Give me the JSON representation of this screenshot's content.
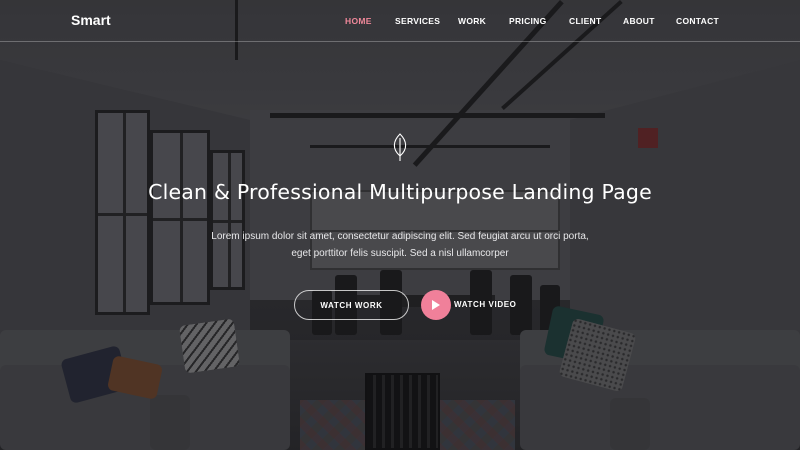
{
  "brand": {
    "logo_text": "Smart"
  },
  "nav": {
    "items": [
      {
        "label": "HOME",
        "active": true
      },
      {
        "label": "SERVICES",
        "active": false
      },
      {
        "label": "WORK",
        "active": false
      },
      {
        "label": "PRICING",
        "active": false
      },
      {
        "label": "CLIENT",
        "active": false
      },
      {
        "label": "ABOUT",
        "active": false
      },
      {
        "label": "CONTACT",
        "active": false
      }
    ]
  },
  "hero": {
    "icon": "leaf-icon",
    "headline": "Clean & Professional Multipurpose Landing Page",
    "subtext_line1": "Lorem ipsum dolor sit amet, consectetur adipiscing elit. Sed feugiat arcu ut orci porta,",
    "subtext_line2": "eget porttitor felis suscipit. Sed a nisl ullamcorper",
    "watch_work_label": "WATCH WORK",
    "watch_video_label": "WATCH VIDEO"
  },
  "colors": {
    "accent": "#f0809a",
    "active_nav": "#f0889a",
    "text": "#ffffff"
  }
}
